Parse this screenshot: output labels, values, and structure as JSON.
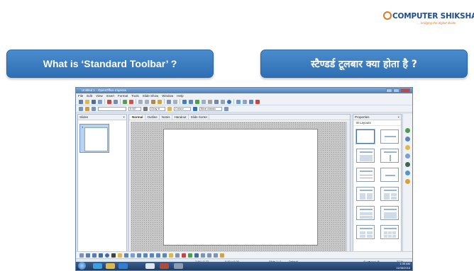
{
  "brand": {
    "name": "COMPUTER SHIKSHA",
    "tagline": "... bridging the digital divide",
    "color": "#1f4e8a",
    "accent": "#e07a22"
  },
  "headings": {
    "english": "What is ‘Standard Toolbar’ ?",
    "hindi": "स्टैण्डर्ड टूलबार क्या होता है ?",
    "pill_color": "#3a7cc0"
  },
  "app": {
    "window_title": "Untitled 1 - OpenOffice Impress",
    "menu": [
      "File",
      "Edit",
      "View",
      "Insert",
      "Format",
      "Tools",
      "Slide Show",
      "Window",
      "Help"
    ],
    "line_width": "0.00\"",
    "line_color": "Gray 6",
    "area_style": "Colour",
    "area_color": "Blue classic",
    "slides_pane_title": "Slides",
    "slide_number": "1",
    "view_tabs": [
      "Normal",
      "Outline",
      "Notes",
      "Handout",
      "Slide Sorter"
    ],
    "active_view_tab": "Normal",
    "properties_title": "Properties",
    "layouts_label": "Layouts",
    "status": {
      "position": "2.84 / 3.73",
      "size": "0.00 x 0.00",
      "slide": "Slide 1 / 1",
      "master": "Default",
      "zoom": "37 %"
    },
    "clock": {
      "time": "1:35 AM",
      "date": "11/08/2016"
    }
  }
}
